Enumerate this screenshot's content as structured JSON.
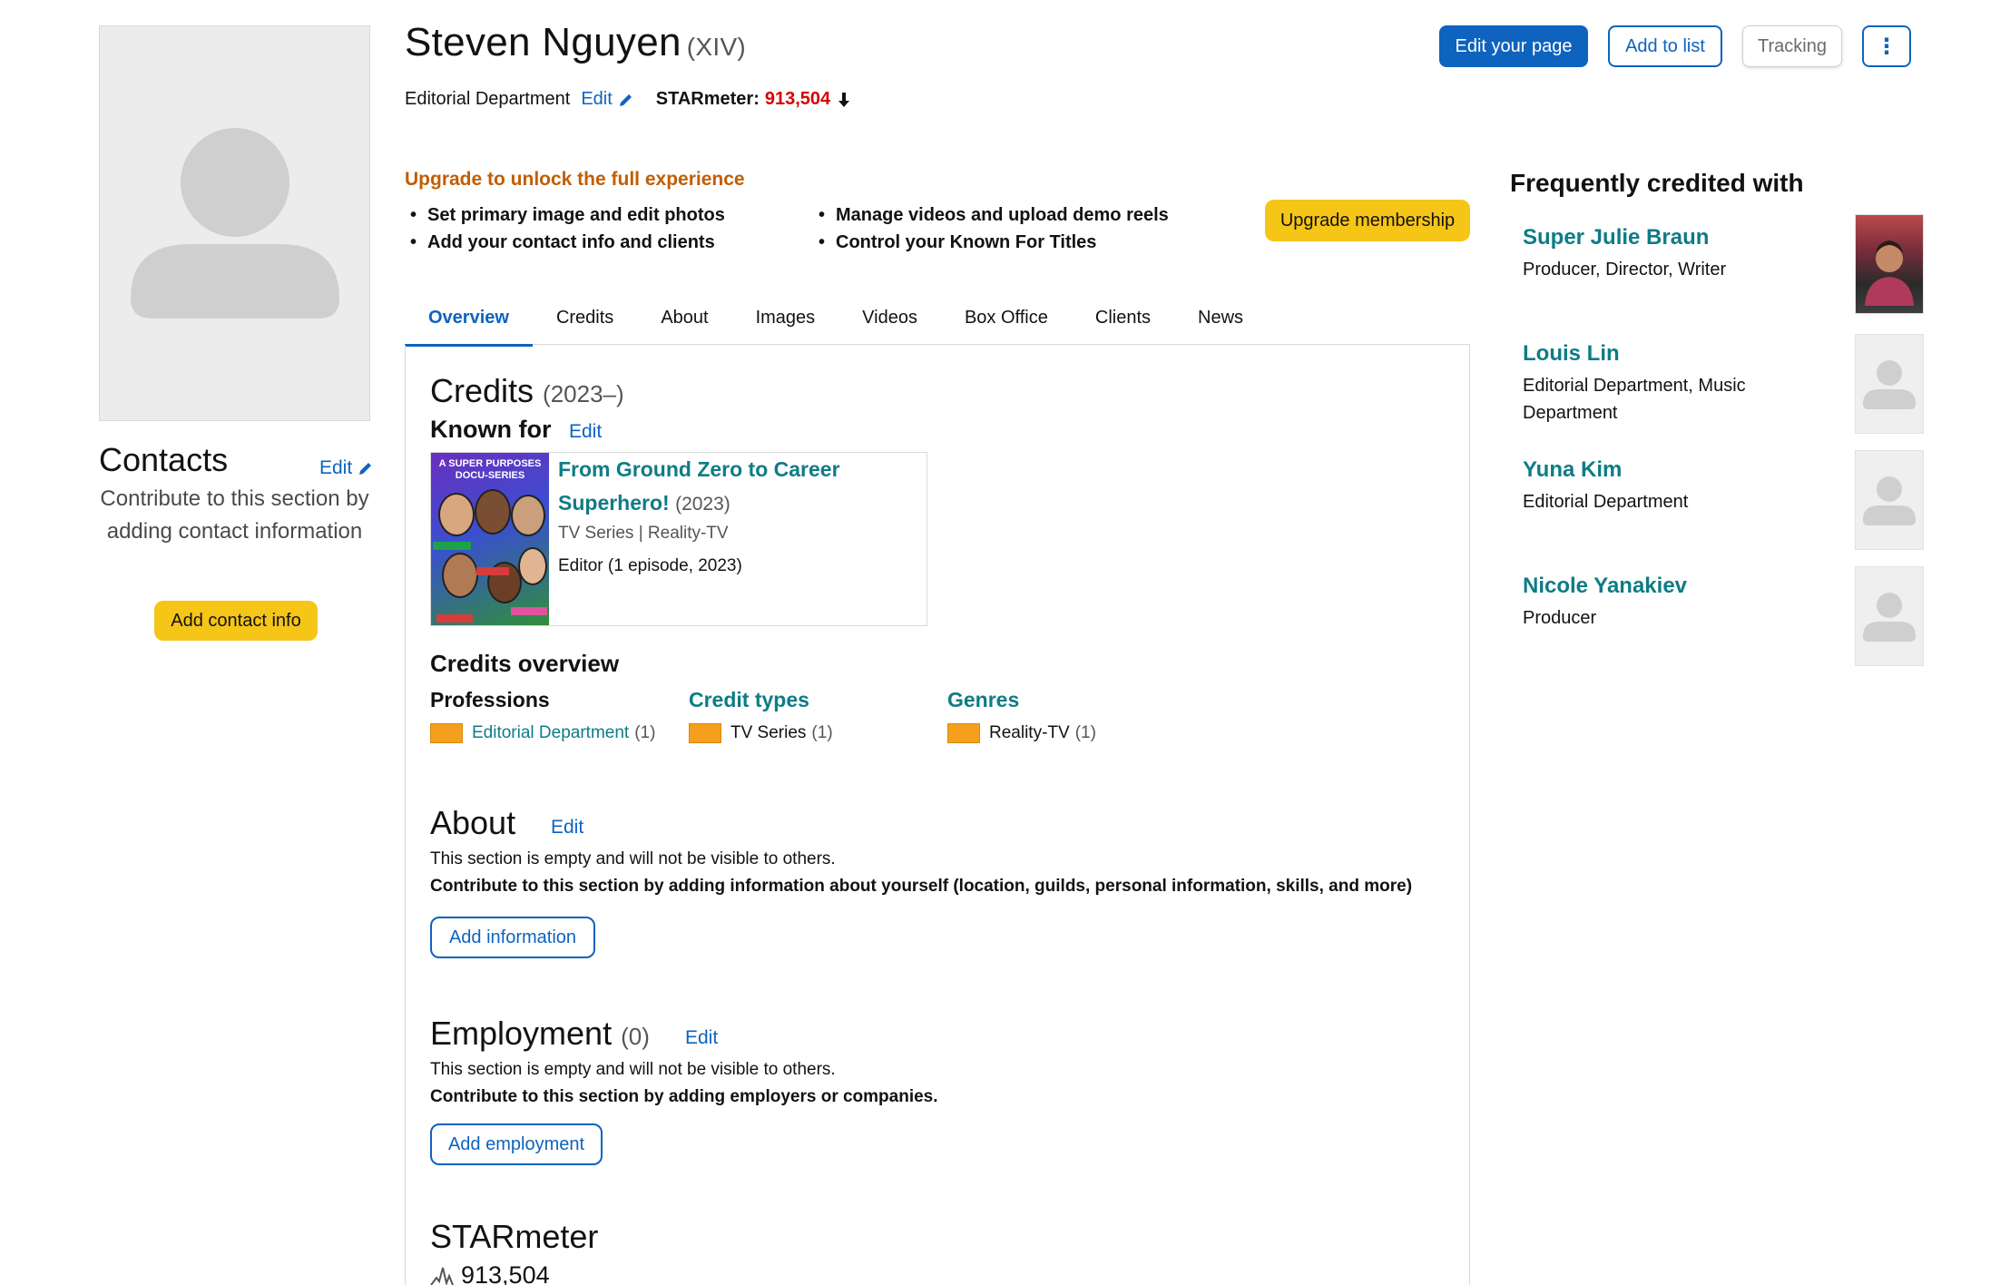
{
  "profile": {
    "name": "Steven Nguyen",
    "name_suffix": "(XIV)",
    "department": "Editorial Department",
    "edit_label": "Edit",
    "starmeter_label": "STARmeter:",
    "starmeter_value": "913,504",
    "starmeter_trend": "down"
  },
  "header_buttons": {
    "edit_page": "Edit your page",
    "add_to_list": "Add to list",
    "tracking": "Tracking",
    "more": "⋮"
  },
  "contacts": {
    "title": "Contacts",
    "edit_label": "Edit",
    "text": "Contribute to this section by adding contact information",
    "button": "Add contact info"
  },
  "upgrade": {
    "title": "Upgrade to unlock the full experience",
    "items_a": [
      "Set primary image and edit photos",
      "Add your contact info and clients"
    ],
    "items_b": [
      "Manage videos and upload demo reels",
      "Control your Known For Titles"
    ],
    "button": "Upgrade membership"
  },
  "tabs": [
    "Overview",
    "Credits",
    "About",
    "Images",
    "Videos",
    "Box Office",
    "Clients",
    "News"
  ],
  "active_tab": "Overview",
  "credits": {
    "title": "Credits",
    "years": "(2023–)",
    "known_for_label": "Known for",
    "known_for_edit": "Edit",
    "known_for": {
      "poster_text": "A SUPER PURPOSES DOCU-SERIES",
      "title": "From Ground Zero to Career Superhero!",
      "year": "(2023)",
      "meta": "TV Series | Reality-TV",
      "role": "Editor (1 episode, 2023)"
    },
    "overview_title": "Credits overview",
    "professions": {
      "heading": "Professions",
      "label": "Editorial Department",
      "count": "(1)"
    },
    "credit_types": {
      "heading": "Credit types",
      "label": "TV Series",
      "count": "(1)"
    },
    "genres": {
      "heading": "Genres",
      "label": "Reality-TV",
      "count": "(1)"
    }
  },
  "about": {
    "title": "About",
    "edit_label": "Edit",
    "empty": "This section is empty and will not be visible to others.",
    "contribute": "Contribute to this section by adding information about yourself (location, guilds, personal information, skills, and more)",
    "button": "Add information"
  },
  "employment": {
    "title": "Employment",
    "count": "(0)",
    "edit_label": "Edit",
    "empty": "This section is empty and will not be visible to others.",
    "contribute": "Contribute to this section by adding employers or companies.",
    "button": "Add employment"
  },
  "starmeter_section": {
    "title": "STARmeter",
    "value": "913,504"
  },
  "frequently_credited": {
    "title": "Frequently credited with",
    "people": [
      {
        "name": "Super Julie Braun",
        "role": "Producer, Director, Writer"
      },
      {
        "name": "Louis Lin",
        "role": "Editorial Department, Music Department"
      },
      {
        "name": "Yuna Kim",
        "role": "Editorial Department"
      },
      {
        "name": "Nicole Yanakiev",
        "role": "Producer"
      }
    ]
  },
  "colors": {
    "brand_yellow": "#f5c518",
    "link_blue": "#0e63be",
    "teal_link": "#0e7c86",
    "upgrade_orange": "#c15e02",
    "starmeter_red": "#d60000",
    "chart_orange": "#f5a01d"
  }
}
